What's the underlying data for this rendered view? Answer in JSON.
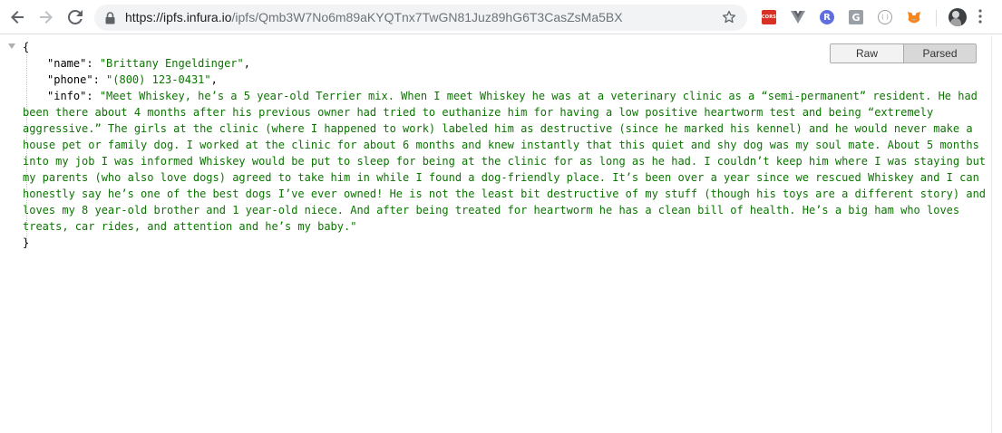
{
  "browser": {
    "url_domain": "https://ipfs.infura.io",
    "url_path": "/ipfs/Qmb3W7No6m89aKYQTnx7TwGN81Juz89hG6T3CasZsMa5BX",
    "extensions": [
      {
        "name": "cors-extension-icon",
        "label": "CORS"
      },
      {
        "name": "vue-devtools-icon",
        "label": ""
      },
      {
        "name": "remix-extension-icon",
        "label": "R"
      },
      {
        "name": "google-translate-icon",
        "label": "G"
      },
      {
        "name": "circle-extension-icon",
        "label": "( )"
      },
      {
        "name": "metamask-icon",
        "label": ""
      }
    ],
    "accent_color": "#5f6368"
  },
  "viewer": {
    "raw_label": "Raw",
    "parsed_label": "Parsed",
    "active_view": "Parsed"
  },
  "json": {
    "open_brace": "{",
    "close_brace": "}",
    "fields": {
      "name_key": "\"name\"",
      "name_value": "\"Brittany Engeldinger\"",
      "phone_key": "\"phone\"",
      "phone_value": "\"(800) 123-0431\"",
      "info_key": "\"info\"",
      "info_value": "\"Meet Whiskey, he’s a 5 year-old Terrier mix. When I meet Whiskey he was at a veterinary clinic as a “semi-permanent” resident. He had been there about 4 months after his previous owner had tried to euthanize him for having a low positive heartworm test and being “extremely aggressive.” The girls at the clinic (where I happened to work) labeled him as destructive (since he marked his kennel) and he would never make a house pet or family dog. I worked at the clinic for about 6 months and knew instantly that this quiet and shy dog was my soul mate. About 5 months into my job I was informed Whiskey would be put to sleep for being at the clinic for as long as he had. I couldn’t keep him where I was staying but my parents (who also love dogs) agreed to take him in while I found a dog-friendly place. It’s been over a year since we rescued Whiskey and I can honestly say he’s one of the best dogs I’ve ever owned! He is not the least bit destructive of my stuff (though his toys are a different story) and loves my 8 year-old brother and 1 year-old niece. And after being treated for heartworm he has a clean bill of health. He’s a big ham who loves treats, car rides, and attention and he’s my baby.\""
    },
    "string_color": "#0b7500"
  }
}
